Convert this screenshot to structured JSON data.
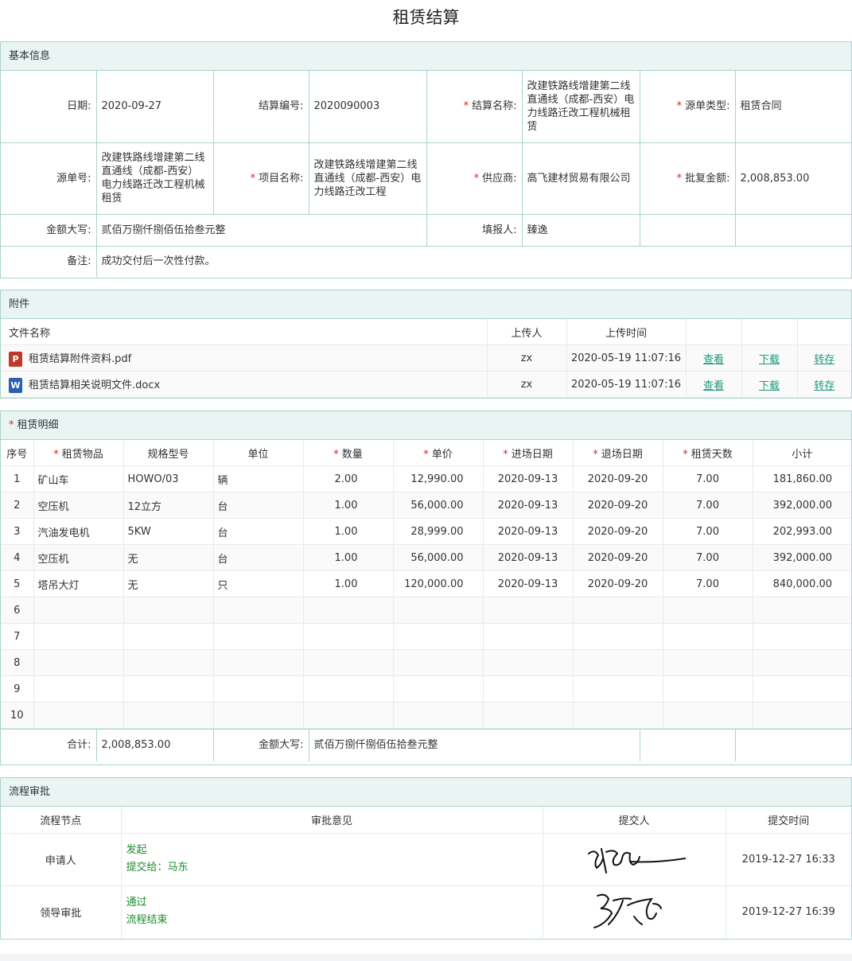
{
  "page_title": "租赁结算",
  "basic": {
    "section": "基本信息",
    "date_label": "日期:",
    "date": "2020-09-27",
    "code_label": "结算编号:",
    "code": "2020090003",
    "name_label": "结算名称:",
    "name": "改建铁路线增建第二线直通线（成都-西安）电力线路迁改工程机械租赁",
    "src_type_label": "源单类型:",
    "src_type": "租赁合同",
    "src_no_label": "源单号:",
    "src_no": "改建铁路线增建第二线直通线（成都-西安）电力线路迁改工程机械租赁",
    "project_label": "项目名称:",
    "project": "改建铁路线增建第二线直通线（成都-西安）电力线路迁改工程",
    "supplier_label": "供应商:",
    "supplier": "高飞建材贸易有限公司",
    "approved_label": "批复金额:",
    "approved": "2,008,853.00",
    "amount_cn_label": "金额大写:",
    "amount_cn": "贰佰万捌仟捌佰伍拾叁元整",
    "reporter_label": "填报人:",
    "reporter": "臻逸",
    "remark_label": "备注:",
    "remark": "成功交付后一次性付款。"
  },
  "attach": {
    "section": "附件",
    "headers": [
      "文件名称",
      "上传人",
      "上传时间"
    ],
    "files": [
      {
        "icon": "pdf-file-icon",
        "badge": "P",
        "name": "租赁结算附件资料.pdf",
        "uploader": "zx",
        "time": "2020-05-19 11:07:16",
        "view": "查看",
        "download": "下载",
        "save": "转存"
      },
      {
        "icon": "word-file-icon",
        "badge": "W",
        "name": "租赁结算相关说明文件.docx",
        "uploader": "zx",
        "time": "2020-05-19 11:07:16",
        "view": "查看",
        "download": "下载",
        "save": "转存"
      }
    ]
  },
  "detail": {
    "section": "租赁明细",
    "headers": [
      "序号",
      "租赁物品",
      "规格型号",
      "单位",
      "数量",
      "单价",
      "进场日期",
      "退场日期",
      "租赁天数",
      "小计"
    ],
    "rows": [
      {
        "no": "1",
        "item": "矿山车",
        "spec": "HOWO/03",
        "unit": "辆",
        "qty": "2.00",
        "price": "12,990.00",
        "in": "2020-09-13",
        "out": "2020-09-20",
        "days": "7.00",
        "sub": "181,860.00"
      },
      {
        "no": "2",
        "item": "空压机",
        "spec": "12立方",
        "unit": "台",
        "qty": "1.00",
        "price": "56,000.00",
        "in": "2020-09-13",
        "out": "2020-09-20",
        "days": "7.00",
        "sub": "392,000.00"
      },
      {
        "no": "3",
        "item": "汽油发电机",
        "spec": "5KW",
        "unit": "台",
        "qty": "1.00",
        "price": "28,999.00",
        "in": "2020-09-13",
        "out": "2020-09-20",
        "days": "7.00",
        "sub": "202,993.00"
      },
      {
        "no": "4",
        "item": "空压机",
        "spec": "无",
        "unit": "台",
        "qty": "1.00",
        "price": "56,000.00",
        "in": "2020-09-13",
        "out": "2020-09-20",
        "days": "7.00",
        "sub": "392,000.00"
      },
      {
        "no": "5",
        "item": "塔吊大灯",
        "spec": "无",
        "unit": "只",
        "qty": "1.00",
        "price": "120,000.00",
        "in": "2020-09-13",
        "out": "2020-09-20",
        "days": "7.00",
        "sub": "840,000.00"
      },
      {
        "no": "6"
      },
      {
        "no": "7"
      },
      {
        "no": "8"
      },
      {
        "no": "9"
      },
      {
        "no": "10"
      }
    ],
    "total_label": "合计:",
    "total": "2,008,853.00",
    "total_cn_label": "金额大写:",
    "total_cn": "贰佰万捌仟捌佰伍拾叁元整"
  },
  "flow": {
    "section": "流程审批",
    "headers": [
      "流程节点",
      "审批意见",
      "提交人",
      "提交时间"
    ],
    "rows": [
      {
        "node": "申请人",
        "op1": "发起",
        "op2": "提交给：马东",
        "signer": "臻逸",
        "time": "2019-12-27 16:33"
      },
      {
        "node": "领导审批",
        "op1": "通过",
        "op2": "流程结束",
        "signer": "马东",
        "time": "2019-12-27 16:39"
      }
    ]
  }
}
